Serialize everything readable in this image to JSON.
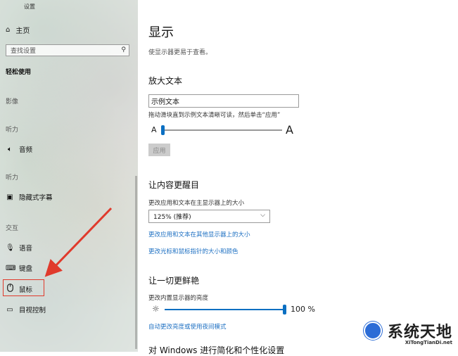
{
  "sidebar": {
    "app_title": "设置",
    "home_label": "主页",
    "search_placeholder": "查找设置",
    "section_title": "轻松使用",
    "categories": {
      "vision": "影像",
      "hearing": "听力",
      "interaction": "交互"
    },
    "items": {
      "audio": "音频",
      "captions": "隐藏式字幕",
      "speech": "语音",
      "keyboard": "键盘",
      "mouse": "鼠标",
      "eye_control": "目视控制"
    }
  },
  "main": {
    "title": "显示",
    "description": "使显示器更易于查看。",
    "enlarge_text": {
      "heading": "放大文本",
      "sample_text": "示例文本",
      "instruction": "拖动滑块直到示例文本清晰可读，然后单击“应用”",
      "small_a": "A",
      "large_a": "A",
      "slider_fraction": 0.0,
      "apply_label": "应用"
    },
    "make_bigger": {
      "heading": "让内容更醒目",
      "label": "更改应用和文本在主显示器上的大小",
      "selected_scale": "125% (推荐)",
      "link_other_displays": "更改应用和文本在其他显示器上的大小",
      "link_pointer": "更改光标和鼠标指针的大小和颜色"
    },
    "brighter": {
      "heading": "让一切更鲜艳",
      "label": "更改内置显示器的亮度",
      "brightness_value": "100 %",
      "brightness_fraction": 1.0,
      "link_night_light": "自动更改亮度或使用夜间模式"
    },
    "cut_heading": "对 Windows 进行简化和个性化设置"
  },
  "watermark": {
    "text": "系统天地",
    "url": "XiTongTianDi.net"
  },
  "colors": {
    "accent": "#0a6fc2",
    "link": "#1c6fc2",
    "highlight_box": "#e03a2c"
  }
}
